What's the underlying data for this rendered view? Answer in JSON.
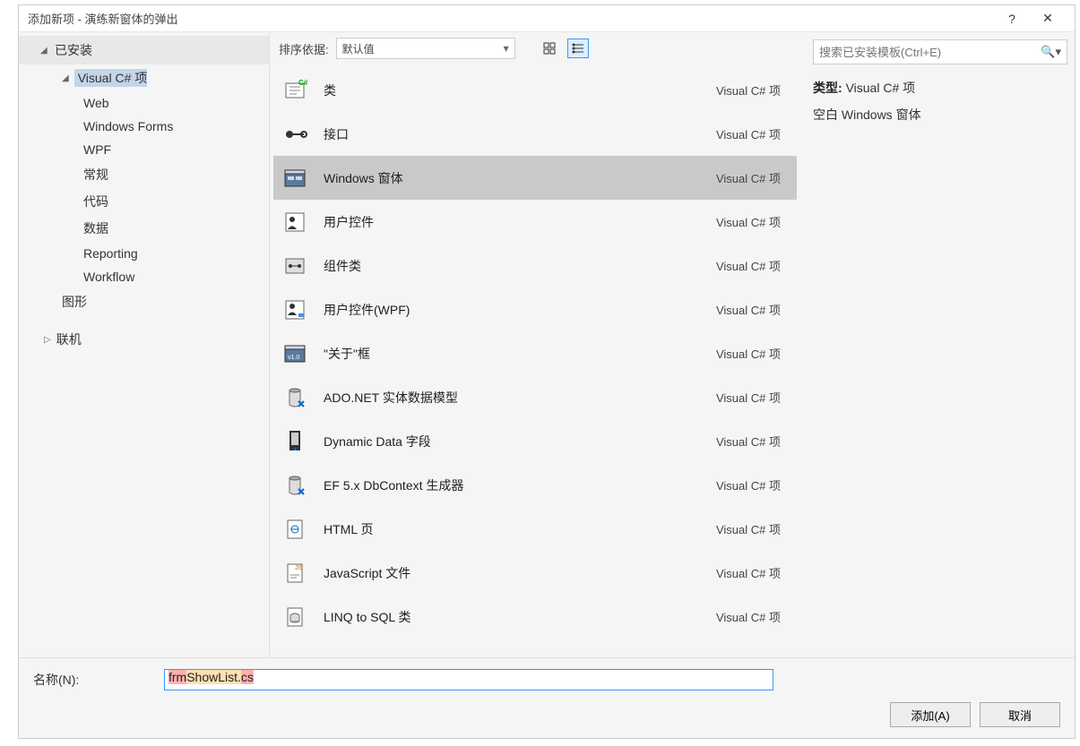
{
  "title": "添加新项 - 演练新窗体的弹出",
  "help": "?",
  "sidebar": {
    "installed": "已安装",
    "nodes": [
      {
        "label": "Visual C# 项",
        "selected": true,
        "children": [
          "Web",
          "Windows Forms",
          "WPF",
          "常规",
          "代码",
          "数据",
          "Reporting",
          "Workflow"
        ]
      },
      {
        "label": "图形"
      }
    ],
    "online": "联机"
  },
  "toolbar": {
    "sort_label": "排序依据:",
    "sort_value": "默认值"
  },
  "templates": [
    {
      "name": "类",
      "icon": "class"
    },
    {
      "name": "接口",
      "icon": "interface"
    },
    {
      "name": "Windows 窗体",
      "icon": "winform",
      "selected": true
    },
    {
      "name": "用户控件",
      "icon": "usercontrol"
    },
    {
      "name": "组件类",
      "icon": "component"
    },
    {
      "name": "用户控件(WPF)",
      "icon": "wpfcontrol"
    },
    {
      "name": "\"关于\"框",
      "icon": "about"
    },
    {
      "name": "ADO.NET 实体数据模型",
      "icon": "ado"
    },
    {
      "name": "Dynamic Data 字段",
      "icon": "dynfield"
    },
    {
      "name": "EF 5.x DbContext 生成器",
      "icon": "ef5"
    },
    {
      "name": "HTML 页",
      "icon": "html"
    },
    {
      "name": "JavaScript 文件",
      "icon": "js"
    },
    {
      "name": "LINQ to SQL 类",
      "icon": "linq"
    }
  ],
  "template_lang": "Visual C# 项",
  "search_placeholder": "搜索已安装模板(Ctrl+E)",
  "details": {
    "type_label": "类型:",
    "type_value": "Visual C# 项",
    "desc": "空白 Windows 窗体"
  },
  "name_label": "名称(N):",
  "name_value_prefix": "frm",
  "name_value_mid": "ShowList.",
  "name_value_ext": "cs",
  "buttons": {
    "add": "添加(A)",
    "cancel": "取消"
  }
}
